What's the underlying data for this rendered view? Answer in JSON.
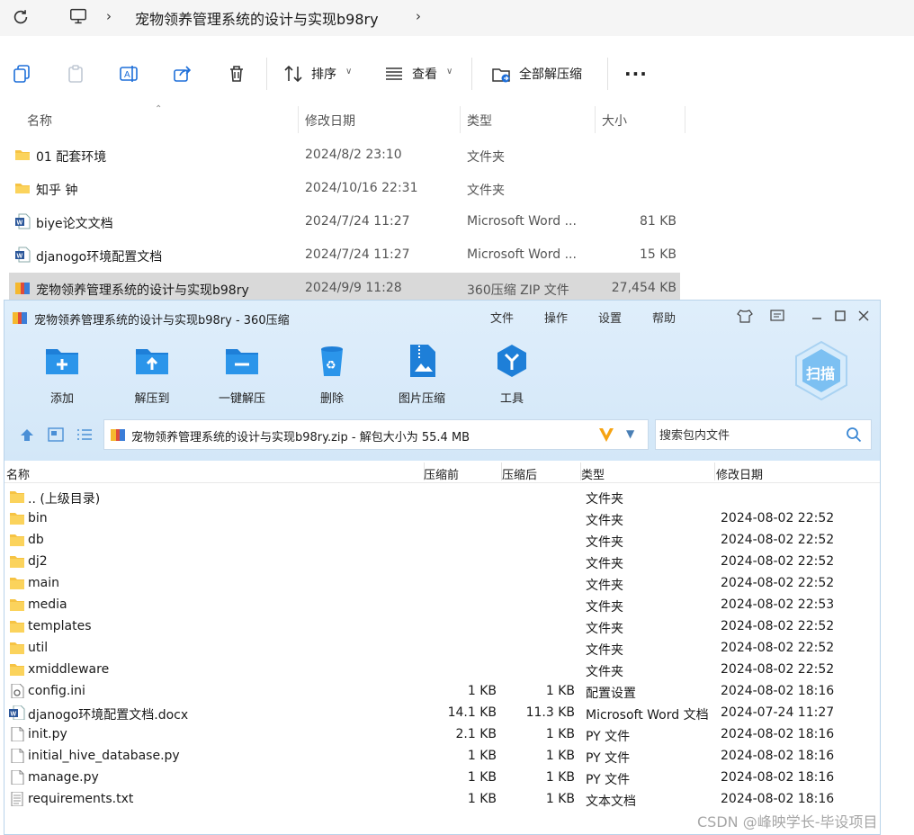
{
  "explorer": {
    "breadcrumb": "宠物领养管理系统的设计与实现b98ry",
    "toolbar": {
      "sort_label": "排序",
      "view_label": "查看",
      "extract_all_label": "全部解压缩"
    },
    "columns": {
      "name": "名称",
      "date": "修改日期",
      "type": "类型",
      "size": "大小"
    },
    "rows": [
      {
        "icon": "folder-icon",
        "name": "01 配套环境",
        "date": "2024/8/2 23:10",
        "type": "文件夹",
        "size": ""
      },
      {
        "icon": "folder-icon",
        "name": "知乎 钟",
        "date": "2024/10/16 22:31",
        "type": "文件夹",
        "size": ""
      },
      {
        "icon": "word-doc-icon",
        "name": "biye论文文档",
        "date": "2024/7/24 11:27",
        "type": "Microsoft Word ...",
        "size": "81 KB"
      },
      {
        "icon": "word-doc-icon",
        "name": "djanogo环境配置文档",
        "date": "2024/7/24 11:27",
        "type": "Microsoft Word ...",
        "size": "15 KB"
      },
      {
        "icon": "zip-archive-icon",
        "name": "宠物领养管理系统的设计与实现b98ry",
        "date": "2024/9/9 11:28",
        "type": "360压缩 ZIP 文件",
        "size": "27,454 KB"
      }
    ]
  },
  "archiver": {
    "title": "宠物领养管理系统的设计与实现b98ry - 360压缩",
    "menu": [
      "文件",
      "操作",
      "设置",
      "帮助"
    ],
    "tools": [
      "添加",
      "解压到",
      "一键解压",
      "删除",
      "图片压缩",
      "工具"
    ],
    "scan_label": "扫描",
    "path": "宠物领养管理系统的设计与实现b98ry.zip - 解包大小为 55.4 MB",
    "search_placeholder": "搜索包内文件",
    "columns": {
      "name": "名称",
      "before": "压缩前",
      "after": "压缩后",
      "type": "类型",
      "modified": "修改日期"
    },
    "rows": [
      {
        "icon": "folder-icon",
        "name": ".. (上级目录)",
        "before": "",
        "after": "",
        "type": "文件夹",
        "modified": ""
      },
      {
        "icon": "folder-icon",
        "name": "bin",
        "before": "",
        "after": "",
        "type": "文件夹",
        "modified": "2024-08-02 22:52"
      },
      {
        "icon": "folder-icon",
        "name": "db",
        "before": "",
        "after": "",
        "type": "文件夹",
        "modified": "2024-08-02 22:52"
      },
      {
        "icon": "folder-icon",
        "name": "dj2",
        "before": "",
        "after": "",
        "type": "文件夹",
        "modified": "2024-08-02 22:52"
      },
      {
        "icon": "folder-icon",
        "name": "main",
        "before": "",
        "after": "",
        "type": "文件夹",
        "modified": "2024-08-02 22:52"
      },
      {
        "icon": "folder-icon",
        "name": "media",
        "before": "",
        "after": "",
        "type": "文件夹",
        "modified": "2024-08-02 22:53"
      },
      {
        "icon": "folder-icon",
        "name": "templates",
        "before": "",
        "after": "",
        "type": "文件夹",
        "modified": "2024-08-02 22:52"
      },
      {
        "icon": "folder-icon",
        "name": "util",
        "before": "",
        "after": "",
        "type": "文件夹",
        "modified": "2024-08-02 22:52"
      },
      {
        "icon": "folder-icon",
        "name": "xmiddleware",
        "before": "",
        "after": "",
        "type": "文件夹",
        "modified": "2024-08-02 22:52"
      },
      {
        "icon": "config-file-icon",
        "name": "config.ini",
        "before": "1 KB",
        "after": "1 KB",
        "type": "配置设置",
        "modified": "2024-08-02 18:16"
      },
      {
        "icon": "word-doc-icon",
        "name": "djanogo环境配置文档.docx",
        "before": "14.1 KB",
        "after": "11.3 KB",
        "type": "Microsoft Word 文档",
        "modified": "2024-07-24 11:27"
      },
      {
        "icon": "file-icon",
        "name": "init.py",
        "before": "2.1 KB",
        "after": "1 KB",
        "type": "PY 文件",
        "modified": "2024-08-02 18:16"
      },
      {
        "icon": "file-icon",
        "name": "initial_hive_database.py",
        "before": "1 KB",
        "after": "1 KB",
        "type": "PY 文件",
        "modified": "2024-08-02 18:16"
      },
      {
        "icon": "file-icon",
        "name": "manage.py",
        "before": "1 KB",
        "after": "1 KB",
        "type": "PY 文件",
        "modified": "2024-08-02 18:16"
      },
      {
        "icon": "text-file-icon",
        "name": "requirements.txt",
        "before": "1 KB",
        "after": "1 KB",
        "type": "文本文档",
        "modified": "2024-08-02 18:16"
      }
    ]
  },
  "watermark": "CSDN @峰映学长-毕设项目",
  "colors": {
    "folder": "#f6c343",
    "accent": "#1e88e5",
    "selection": "#d9d9d9",
    "window_top": "#dceafa"
  }
}
